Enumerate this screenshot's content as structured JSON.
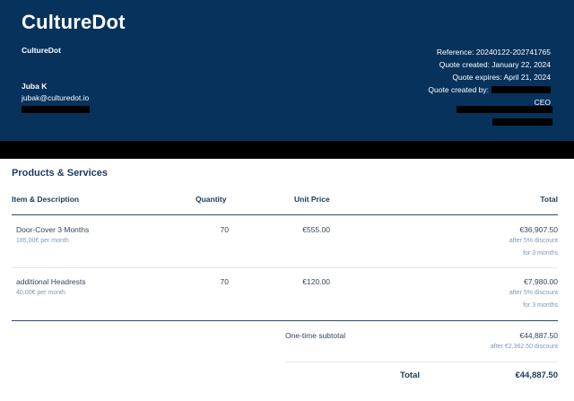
{
  "header": {
    "brand": "CultureDot",
    "company": "CultureDot",
    "contact_name": "Juba K",
    "contact_email": "jubak@culturedot.io",
    "reference": "Reference: 20240122-202741765",
    "quote_created": "Quote created: January 22, 2024",
    "quote_expires": "Quote expires: April 21, 2024",
    "created_by_label": "Quote created by:",
    "role": "CEO"
  },
  "products": {
    "title": "Products & Services",
    "columns": {
      "item": "Item & Description",
      "quantity": "Quantity",
      "unit_price": "Unit Price",
      "total": "Total"
    },
    "rows": [
      {
        "name": "Door-Cover 3 Months",
        "detail": "185,00€ per month",
        "quantity": "70",
        "unit_price": "€555.00",
        "total": "€36,907.50",
        "discount": "after 5% discount",
        "term": "for 3 months"
      },
      {
        "name": "additional Headrests",
        "detail": "40,00€ per month",
        "quantity": "70",
        "unit_price": "€120.00",
        "total": "€7,980.00",
        "discount": "after 5% discount",
        "term": "for 3 months"
      }
    ]
  },
  "summary": {
    "subtotal_label": "One-time subtotal",
    "subtotal_value": "€44,887.50",
    "subtotal_discount": "after €2,362.50 discount",
    "total_label": "Total",
    "total_value": "€44,887.50"
  }
}
